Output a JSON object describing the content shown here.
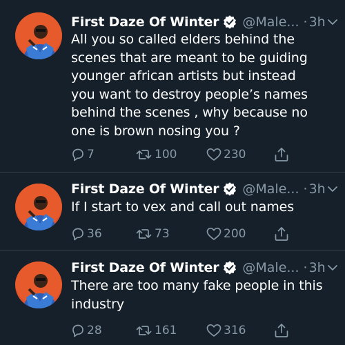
{
  "tweets": [
    {
      "display_name": "First Daze Of Winter",
      "handle": "@Male...",
      "separator": "·",
      "time": "3h",
      "text": "All you so called elders behind the\nscenes that are meant to be guiding\nyounger african artists but instead\nyou want to destroy people’s names\nbehind the scenes , why because no\none is brown nosing you ?",
      "replies": "7",
      "retweets": "100",
      "likes": "230"
    },
    {
      "display_name": "First Daze Of Winter",
      "handle": "@Male...",
      "separator": "·",
      "time": "3h",
      "text": "If I start to vex and call out names",
      "replies": "36",
      "retweets": "73",
      "likes": "200"
    },
    {
      "display_name": "First Daze Of Winter",
      "handle": "@Male...",
      "separator": "·",
      "time": "3h",
      "text": "There are too many fake people in this\nindustry",
      "replies": "28",
      "retweets": "161",
      "likes": "316"
    }
  ],
  "icons": {
    "verified": "verified-badge-icon",
    "menu": "chevron-down-icon",
    "reply": "reply-icon",
    "retweet": "retweet-icon",
    "like": "heart-icon",
    "share": "share-icon"
  },
  "colors": {
    "background": "#15202b",
    "text": "#ffffff",
    "secondary_text": "#8899a6",
    "divider": "#38444d",
    "verified": "#ffffff"
  }
}
